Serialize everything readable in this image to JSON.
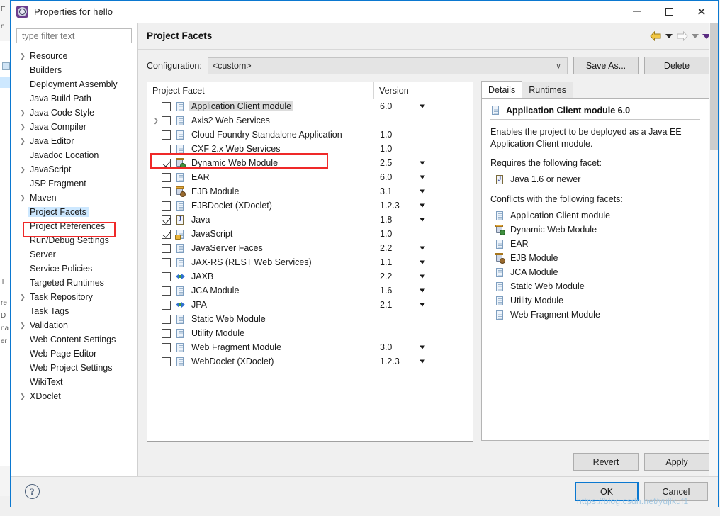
{
  "window": {
    "title": "Properties for hello",
    "icon": "eclipse-properties-icon",
    "minimize_label": "—",
    "maximize_label": "□",
    "close_label": "✕"
  },
  "sidebar": {
    "filter_placeholder": "type filter text",
    "filter_value": "",
    "selected": "Project Facets",
    "items": [
      {
        "label": "Resource",
        "expandable": true
      },
      {
        "label": "Builders",
        "expandable": false
      },
      {
        "label": "Deployment Assembly",
        "expandable": false
      },
      {
        "label": "Java Build Path",
        "expandable": false
      },
      {
        "label": "Java Code Style",
        "expandable": true
      },
      {
        "label": "Java Compiler",
        "expandable": true
      },
      {
        "label": "Java Editor",
        "expandable": true
      },
      {
        "label": "Javadoc Location",
        "expandable": false
      },
      {
        "label": "JavaScript",
        "expandable": true
      },
      {
        "label": "JSP Fragment",
        "expandable": false
      },
      {
        "label": "Maven",
        "expandable": true
      },
      {
        "label": "Project Facets",
        "expandable": false
      },
      {
        "label": "Project References",
        "expandable": false
      },
      {
        "label": "Run/Debug Settings",
        "expandable": false
      },
      {
        "label": "Server",
        "expandable": false
      },
      {
        "label": "Service Policies",
        "expandable": false
      },
      {
        "label": "Targeted Runtimes",
        "expandable": false
      },
      {
        "label": "Task Repository",
        "expandable": true
      },
      {
        "label": "Task Tags",
        "expandable": false
      },
      {
        "label": "Validation",
        "expandable": true
      },
      {
        "label": "Web Content Settings",
        "expandable": false
      },
      {
        "label": "Web Page Editor",
        "expandable": false
      },
      {
        "label": "Web Project Settings",
        "expandable": false
      },
      {
        "label": "WikiText",
        "expandable": false
      },
      {
        "label": "XDoclet",
        "expandable": true
      }
    ]
  },
  "page": {
    "title": "Project Facets",
    "nav": {
      "back_icon": "back-arrow-icon",
      "back_menu_icon": "chevron-down-icon",
      "forward_icon": "forward-arrow-icon",
      "forward_menu_icon": "chevron-down-icon",
      "more_icon": "chevron-down-icon"
    }
  },
  "config": {
    "label": "Configuration:",
    "value": "<custom>",
    "chevron": "∨",
    "save_as_label": "Save As...",
    "delete_label": "Delete"
  },
  "facet_table": {
    "columns": [
      "Project Facet",
      "Version"
    ],
    "highlight_row": "Dynamic Web Module",
    "rows": [
      {
        "name": "Application Client module",
        "version": "6.0",
        "checked": false,
        "caret": true,
        "icon": "doc-icon",
        "expandable": false,
        "highlighted": true
      },
      {
        "name": "Axis2 Web Services",
        "version": "",
        "checked": false,
        "caret": false,
        "icon": "doc-icon",
        "expandable": true,
        "highlighted": false
      },
      {
        "name": "Cloud Foundry Standalone Application",
        "version": "1.0",
        "checked": false,
        "caret": false,
        "icon": "doc-icon",
        "expandable": false,
        "highlighted": false
      },
      {
        "name": "CXF 2.x Web Services",
        "version": "1.0",
        "checked": false,
        "caret": false,
        "icon": "doc-icon",
        "expandable": false,
        "highlighted": false
      },
      {
        "name": "Dynamic Web Module",
        "version": "2.5",
        "checked": true,
        "caret": true,
        "icon": "web-module-icon",
        "expandable": false,
        "highlighted": false
      },
      {
        "name": "EAR",
        "version": "6.0",
        "checked": false,
        "caret": true,
        "icon": "doc-icon",
        "expandable": false,
        "highlighted": false
      },
      {
        "name": "EJB Module",
        "version": "3.1",
        "checked": false,
        "caret": true,
        "icon": "ejb-module-icon",
        "expandable": false,
        "highlighted": false
      },
      {
        "name": "EJBDoclet (XDoclet)",
        "version": "1.2.3",
        "checked": false,
        "caret": true,
        "icon": "doc-icon",
        "expandable": false,
        "highlighted": false
      },
      {
        "name": "Java",
        "version": "1.8",
        "checked": true,
        "caret": true,
        "icon": "java-icon",
        "expandable": false,
        "highlighted": false
      },
      {
        "name": "JavaScript",
        "version": "1.0",
        "checked": true,
        "caret": false,
        "icon": "javascript-icon",
        "expandable": false,
        "highlighted": false
      },
      {
        "name": "JavaServer Faces",
        "version": "2.2",
        "checked": false,
        "caret": true,
        "icon": "doc-icon",
        "expandable": false,
        "highlighted": false
      },
      {
        "name": "JAX-RS (REST Web Services)",
        "version": "1.1",
        "checked": false,
        "caret": true,
        "icon": "doc-icon",
        "expandable": false,
        "highlighted": false
      },
      {
        "name": "JAXB",
        "version": "2.2",
        "checked": false,
        "caret": true,
        "icon": "xml-icon",
        "expandable": false,
        "highlighted": false
      },
      {
        "name": "JCA Module",
        "version": "1.6",
        "checked": false,
        "caret": true,
        "icon": "doc-icon",
        "expandable": false,
        "highlighted": false
      },
      {
        "name": "JPA",
        "version": "2.1",
        "checked": false,
        "caret": true,
        "icon": "xml-icon",
        "expandable": false,
        "highlighted": false
      },
      {
        "name": "Static Web Module",
        "version": "",
        "checked": false,
        "caret": false,
        "icon": "doc-icon",
        "expandable": false,
        "highlighted": false
      },
      {
        "name": "Utility Module",
        "version": "",
        "checked": false,
        "caret": false,
        "icon": "doc-icon",
        "expandable": false,
        "highlighted": false
      },
      {
        "name": "Web Fragment Module",
        "version": "3.0",
        "checked": false,
        "caret": true,
        "icon": "doc-icon",
        "expandable": false,
        "highlighted": false
      },
      {
        "name": "WebDoclet (XDoclet)",
        "version": "1.2.3",
        "checked": false,
        "caret": true,
        "icon": "doc-icon",
        "expandable": false,
        "highlighted": false
      }
    ]
  },
  "details": {
    "tabs": [
      {
        "label": "Details",
        "active": true
      },
      {
        "label": "Runtimes",
        "active": false
      }
    ],
    "heading": "Application Client module 6.0",
    "heading_icon": "doc-icon",
    "description": "Enables the project to be deployed as a Java EE Application Client module.",
    "requires_label": "Requires the following facet:",
    "requires": [
      {
        "label": "Java 1.6 or newer",
        "icon": "java-icon"
      }
    ],
    "conflicts_label": "Conflicts with the following facets:",
    "conflicts": [
      {
        "label": "Application Client module",
        "icon": "doc-icon"
      },
      {
        "label": "Dynamic Web Module",
        "icon": "web-module-icon"
      },
      {
        "label": "EAR",
        "icon": "doc-icon"
      },
      {
        "label": "EJB Module",
        "icon": "ejb-module-icon"
      },
      {
        "label": "JCA Module",
        "icon": "doc-icon"
      },
      {
        "label": "Static Web Module",
        "icon": "doc-icon"
      },
      {
        "label": "Utility Module",
        "icon": "doc-icon"
      },
      {
        "label": "Web Fragment Module",
        "icon": "doc-icon"
      }
    ]
  },
  "actions": {
    "revert_label": "Revert",
    "apply_label": "Apply",
    "ok_label": "OK",
    "cancel_label": "Cancel",
    "help_icon": "help-icon",
    "help_glyph": "?"
  },
  "watermark": "https://blog.csdn.net/yujikuf1",
  "colors": {
    "accent": "#0b78d0",
    "highlight_box": "#ef2929",
    "selection": "#cde8ff",
    "row_highlight": "#dcdcdc"
  },
  "backdrop": {
    "labels": [
      "E",
      "n",
      "D",
      "re",
      "na",
      "er",
      "T"
    ]
  }
}
